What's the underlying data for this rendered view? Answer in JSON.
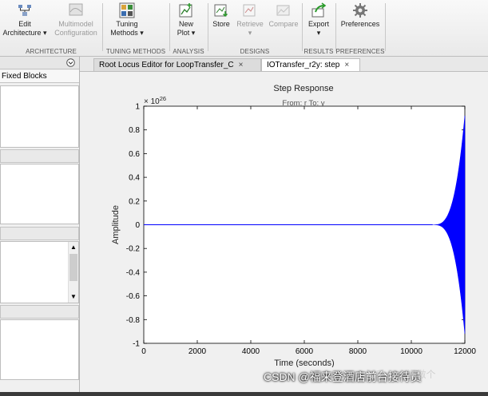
{
  "toolstrip": {
    "buttons": [
      {
        "label1": "Edit",
        "label2": "Architecture ▾"
      },
      {
        "label1": "Multimodel",
        "label2": "Configuration"
      },
      {
        "label1": "Tuning",
        "label2": "Methods ▾"
      },
      {
        "label1": "New",
        "label2": "Plot ▾"
      },
      {
        "label1": "Store",
        "label2": ""
      },
      {
        "label1": "Retrieve",
        "label2": "▾"
      },
      {
        "label1": "Compare",
        "label2": ""
      },
      {
        "label1": "Export",
        "label2": "▾"
      },
      {
        "label1": "Preferences",
        "label2": ""
      }
    ],
    "groups": [
      "ARCHITECTURE",
      "TUNING METHODS",
      "ANALYSIS",
      "DESIGNS",
      "RESULTS",
      "PREFERENCES"
    ]
  },
  "left_panel": {
    "title": "Fixed Blocks",
    "menu_icon": "circle-chevron-down-icon"
  },
  "tabs": [
    {
      "label": "Root Locus Editor for LoopTransfer_C",
      "close": "×"
    },
    {
      "label": "IOTransfer_r2y: step",
      "close": "×"
    }
  ],
  "chart_data": {
    "type": "line",
    "title": "Step Response",
    "subtitle": "From: r  To: y",
    "xlabel": "Time (seconds)",
    "ylabel": "Amplitude",
    "exponent_label": "× 10^26",
    "exponent_base": "× 10",
    "exponent_power": "26",
    "xlim": [
      0,
      12000
    ],
    "ylim": [
      -1,
      1
    ],
    "x_ticks": [
      0,
      2000,
      4000,
      6000,
      8000,
      10000,
      12000
    ],
    "x_tick_labels": [
      "0",
      "2000",
      "4000",
      "6000",
      "8000",
      "10000",
      "12000"
    ],
    "y_ticks": [
      -1,
      -0.8,
      -0.6,
      -0.4,
      -0.2,
      0,
      0.2,
      0.4,
      0.6,
      0.8,
      1
    ],
    "y_tick_labels": [
      "-1",
      "-0.8",
      "-0.6",
      "-0.4",
      "-0.2",
      "0",
      "0.2",
      "0.4",
      "0.6",
      "0.8",
      "1"
    ],
    "series": [
      {
        "envelope_start_x": 10800,
        "envelope_end_x": 12000,
        "envelope_end_amplitude": 0.92,
        "color": "#0000ff"
      }
    ]
  },
  "watermark": {
    "csdn": "CSDN @福来登酒店前台接待员",
    "zhihu": "知乎 @上课做个"
  },
  "colors": {
    "line": "#0000ff",
    "axis": "#000000",
    "accent": "#c9d8ee"
  }
}
